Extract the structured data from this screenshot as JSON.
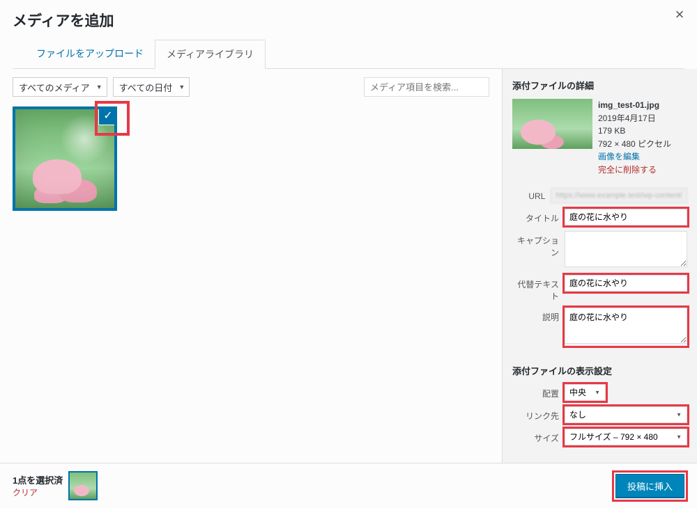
{
  "modal": {
    "title": "メディアを追加",
    "close_label": "×"
  },
  "tabs": {
    "upload": "ファイルをアップロード",
    "library": "メディアライブラリ"
  },
  "toolbar": {
    "filter_type": "すべてのメディア",
    "filter_date": "すべての日付",
    "search_placeholder": "メディア項目を検索..."
  },
  "details": {
    "section_title": "添付ファイルの詳細",
    "filename": "img_test-01.jpg",
    "date": "2019年4月17日",
    "filesize": "179 KB",
    "dimensions": "792 × 480 ピクセル",
    "edit_link": "画像を編集",
    "delete_link": "完全に削除する",
    "fields": {
      "url_label": "URL",
      "url_value": "https://www.example.test/wp-content/",
      "title_label": "タイトル",
      "title_value": "庭の花に水やり",
      "caption_label": "キャプション",
      "caption_value": "",
      "alt_label": "代替テキスト",
      "alt_value": "庭の花に水やり",
      "desc_label": "説明",
      "desc_value": "庭の花に水やり"
    }
  },
  "display": {
    "section_title": "添付ファイルの表示設定",
    "align_label": "配置",
    "align_value": "中央",
    "linkto_label": "リンク先",
    "linkto_value": "なし",
    "size_label": "サイズ",
    "size_value": "フルサイズ – 792 × 480"
  },
  "footer": {
    "selected_count": "1点を選択済",
    "clear": "クリア",
    "insert": "投稿に挿入"
  }
}
